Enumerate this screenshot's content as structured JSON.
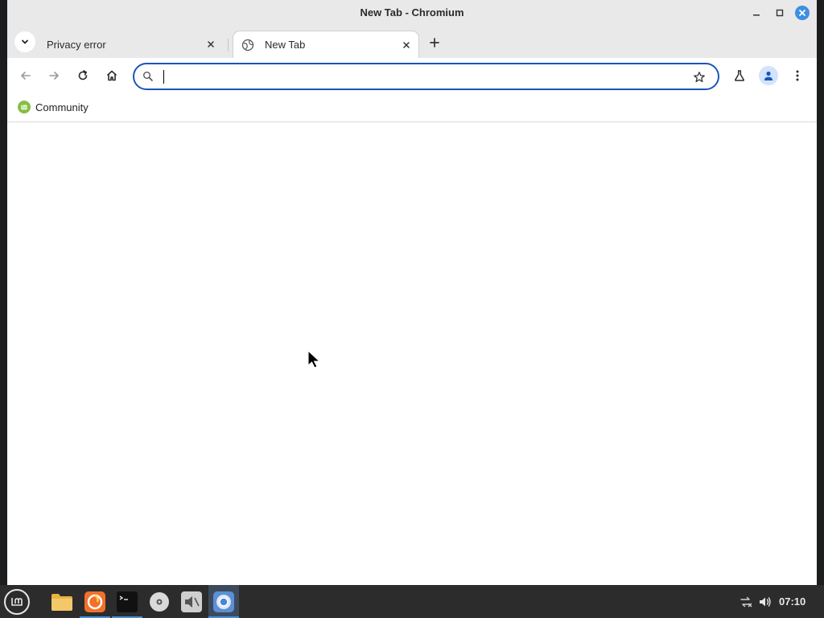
{
  "window": {
    "title": "New Tab - Chromium"
  },
  "tabs": [
    {
      "title": "Privacy error",
      "active": false
    },
    {
      "title": "New Tab",
      "active": true
    }
  ],
  "toolbar": {
    "omnibox_value": "",
    "omnibox_placeholder": ""
  },
  "bookmarks": [
    {
      "label": "Community",
      "icon": "linux-mint-icon"
    }
  ],
  "taskbar": {
    "clock": "07:10",
    "launchers": [
      "files-icon",
      "firefox-icon",
      "terminal-icon",
      "disc-icon",
      "volume-muted-app-icon",
      "chromium-icon"
    ]
  },
  "colors": {
    "accent": "#1a55b9",
    "close_button": "#3d8fe0",
    "taskbar": "#2c2c2c",
    "mint_green": "#86be43"
  }
}
